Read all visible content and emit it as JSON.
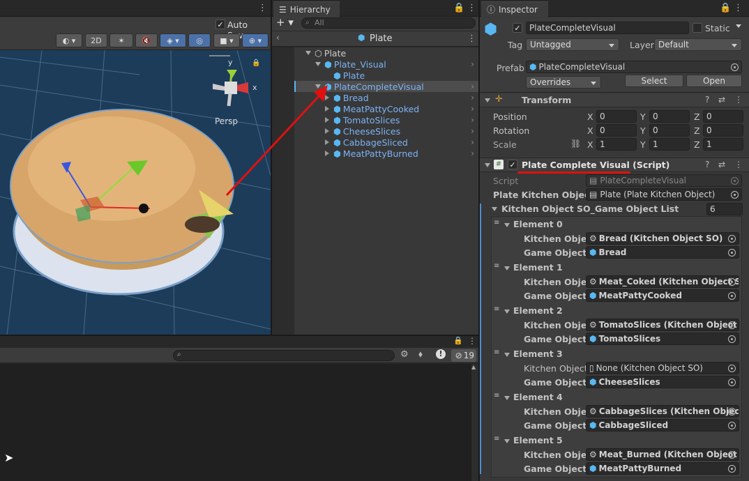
{
  "scene": {
    "auto_save_label": "Auto Save",
    "btn_2d": "2D",
    "persp_label": "Persp",
    "axis_y": "y",
    "axis_x": "x"
  },
  "hierarchy": {
    "tab_label": "Hierarchy",
    "search_placeholder": "All",
    "breadcrumb": "Plate",
    "items": [
      {
        "label": "Plate"
      },
      {
        "label": "Plate_Visual"
      },
      {
        "label": "Plate"
      },
      {
        "label": "PlateCompleteVisual"
      },
      {
        "label": "Bread"
      },
      {
        "label": "MeatPattyCooked"
      },
      {
        "label": "TomatoSlices"
      },
      {
        "label": "CheeseSlices"
      },
      {
        "label": "CabbageSliced"
      },
      {
        "label": "MeatPattyBurned"
      }
    ]
  },
  "console": {
    "count": "19"
  },
  "inspector": {
    "tab_label": "Inspector",
    "object_name": "PlateCompleteVisual",
    "static_label": "Static",
    "tag_label": "Tag",
    "tag_value": "Untagged",
    "layer_label": "Layer",
    "layer_value": "Default",
    "prefab_label": "Prefab",
    "prefab_value": "PlateCompleteVisual",
    "overrides_label": "Overrides",
    "select_label": "Select",
    "open_label": "Open",
    "transform": {
      "title": "Transform",
      "rows": [
        {
          "label": "Position",
          "x": "0",
          "y": "0",
          "z": "0"
        },
        {
          "label": "Rotation",
          "x": "0",
          "y": "0",
          "z": "0"
        },
        {
          "label": "Scale",
          "x": "1",
          "y": "1",
          "z": "1"
        }
      ],
      "x": "X",
      "y": "Y",
      "z": "Z"
    },
    "script_component": {
      "title": "Plate Complete Visual (Script)",
      "script_label": "Script",
      "script_value": "PlateCompleteVisual",
      "pko_label": "Plate Kitchen Object",
      "pko_value": "Plate (Plate Kitchen Object)",
      "list_label": "Kitchen Object SO_Game Object List",
      "list_count": "6",
      "ko_label": "Kitchen Object",
      "go_label": "Game Object",
      "elements": [
        {
          "title": "Element 0",
          "ko": "Bread (Kitchen Object SO)",
          "go": "Bread"
        },
        {
          "title": "Element 1",
          "ko": "Meat_Coked (Kitchen Object SO",
          "go": "MeatPattyCooked"
        },
        {
          "title": "Element 2",
          "ko": "TomatoSlices (Kitchen Object S",
          "go": "TomatoSlices"
        },
        {
          "title": "Element 3",
          "ko": "None (Kitchen Object SO)",
          "go": "CheeseSlices"
        },
        {
          "title": "Element 4",
          "ko": "CabbageSlices (Kitchen Object",
          "go": "CabbageSliced"
        },
        {
          "title": "Element 5",
          "ko": "Meat_Burned (Kitchen Object S",
          "go": "MeatPattyBurned"
        }
      ]
    }
  },
  "colors": {
    "accent": "#4b71a8",
    "arrow": "#e01010",
    "link": "#7cb3f5"
  }
}
